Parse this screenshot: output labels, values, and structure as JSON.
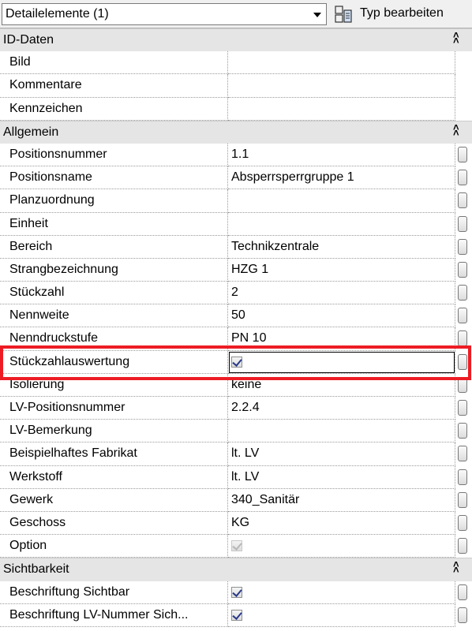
{
  "header": {
    "selector_label": "Detailelemente (1)",
    "type_button_label": "Typ bearbeiten"
  },
  "rows": [
    {
      "kind": "section",
      "label": "ID-Daten",
      "icon": "collapse-icon"
    },
    {
      "kind": "prop",
      "name": "Bild",
      "value": "",
      "param": false
    },
    {
      "kind": "prop",
      "name": "Kommentare",
      "value": "",
      "param": false
    },
    {
      "kind": "prop",
      "name": "Kennzeichen",
      "value": "",
      "param": false
    },
    {
      "kind": "section",
      "label": "Allgemein",
      "icon": "collapse-icon"
    },
    {
      "kind": "prop",
      "name": "Positionsnummer",
      "value": "1.1",
      "param": true
    },
    {
      "kind": "prop",
      "name": "Positionsname",
      "value": "Absperrsperrgruppe 1",
      "param": true
    },
    {
      "kind": "prop",
      "name": "Planzuordnung",
      "value": "",
      "param": true
    },
    {
      "kind": "prop",
      "name": "Einheit",
      "value": "",
      "param": true
    },
    {
      "kind": "prop",
      "name": "Bereich",
      "value": "Technikzentrale",
      "param": true
    },
    {
      "kind": "prop",
      "name": "Strangbezeichnung",
      "value": "HZG 1",
      "param": true
    },
    {
      "kind": "prop",
      "name": "Stückzahl",
      "value": "2",
      "param": true
    },
    {
      "kind": "prop",
      "name": "Nennweite",
      "value": "50",
      "param": true
    },
    {
      "kind": "prop",
      "name": "Nenndruckstufe",
      "value": "PN 10",
      "param": true
    },
    {
      "kind": "prop",
      "name": "Stückzahlauswertung",
      "checkbox": "checked",
      "param": true,
      "selected": true
    },
    {
      "kind": "prop",
      "name": "Isolierung",
      "value": "keine",
      "param": true
    },
    {
      "kind": "prop",
      "name": "LV-Positionsnummer",
      "value": "2.2.4",
      "param": true
    },
    {
      "kind": "prop",
      "name": "LV-Bemerkung",
      "value": "",
      "param": true
    },
    {
      "kind": "prop",
      "name": "Beispielhaftes Fabrikat",
      "value": "lt. LV",
      "param": true
    },
    {
      "kind": "prop",
      "name": "Werkstoff",
      "value": "lt. LV",
      "param": true
    },
    {
      "kind": "prop",
      "name": "Gewerk",
      "value": "340_Sanitär",
      "param": true
    },
    {
      "kind": "prop",
      "name": "Geschoss",
      "value": "KG",
      "param": true
    },
    {
      "kind": "prop",
      "name": "Option",
      "checkbox": "disabled",
      "param": true
    },
    {
      "kind": "section",
      "label": "Sichtbarkeit",
      "icon": "collapse-icon"
    },
    {
      "kind": "prop",
      "name": "Beschriftung Sichtbar",
      "checkbox": "checked",
      "param": true
    },
    {
      "kind": "prop",
      "name": "Beschriftung LV-Nummer Sich...",
      "checkbox": "checked",
      "param": true
    }
  ],
  "colors": {
    "highlight": "#ed1c24",
    "section_bg": "#e5e5e5"
  }
}
